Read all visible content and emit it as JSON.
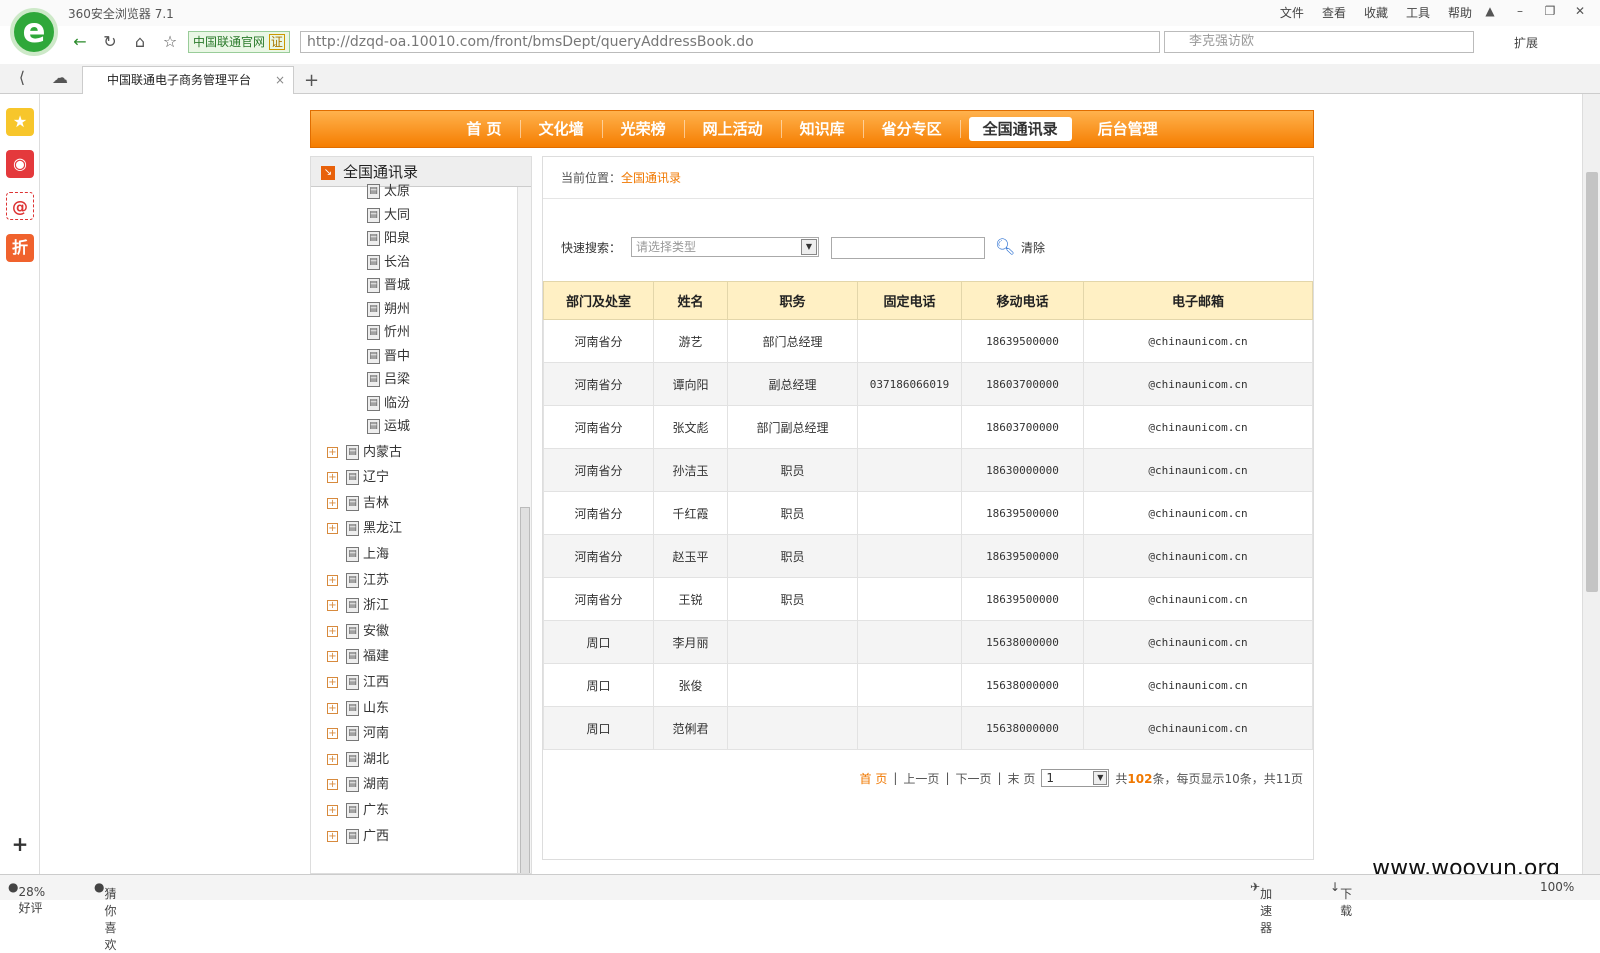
{
  "browser": {
    "app_title": "360安全浏览器 7.1",
    "menu": [
      "文件",
      "查看",
      "收藏",
      "工具",
      "帮助"
    ],
    "cert_label": "中国联通官网",
    "cert_badge": "证",
    "url": "http://dzqd-oa.10010.com/front/bmsDept/queryAddressBook.do",
    "search_placeholder": "李克强访欧",
    "extension_label": "扩展",
    "tab_title": "中国联通电子商务管理平台"
  },
  "nav": {
    "items": [
      {
        "label": "首 页"
      },
      {
        "label": "文化墙"
      },
      {
        "label": "光荣榜"
      },
      {
        "label": "网上活动"
      },
      {
        "label": "知识库"
      },
      {
        "label": "省分专区"
      },
      {
        "label": "全国通讯录",
        "active": true
      },
      {
        "label": "后台管理"
      }
    ]
  },
  "sidebar": {
    "title": "全国通讯录",
    "sub_nodes": [
      "太原",
      "大同",
      "阳泉",
      "长治",
      "晋城",
      "朔州",
      "忻州",
      "晋中",
      "吕梁",
      "临汾",
      "运城"
    ],
    "provinces": [
      {
        "name": "内蒙古",
        "expandable": true
      },
      {
        "name": "辽宁",
        "expandable": true
      },
      {
        "name": "吉林",
        "expandable": true
      },
      {
        "name": "黑龙江",
        "expandable": true
      },
      {
        "name": "上海",
        "expandable": false
      },
      {
        "name": "江苏",
        "expandable": true
      },
      {
        "name": "浙江",
        "expandable": true
      },
      {
        "name": "安徽",
        "expandable": true
      },
      {
        "name": "福建",
        "expandable": true
      },
      {
        "name": "江西",
        "expandable": true
      },
      {
        "name": "山东",
        "expandable": true
      },
      {
        "name": "河南",
        "expandable": true
      },
      {
        "name": "湖北",
        "expandable": true
      },
      {
        "name": "湖南",
        "expandable": true
      },
      {
        "name": "广东",
        "expandable": true
      },
      {
        "name": "广西",
        "expandable": true
      }
    ]
  },
  "breadcrumb": {
    "label": "当前位置：",
    "current": "全国通讯录"
  },
  "search": {
    "label": "快速搜索：",
    "type_placeholder": "请选择类型",
    "clear_label": "清除"
  },
  "table": {
    "headers": [
      "部门及处室",
      "姓名",
      "职务",
      "固定电话",
      "移动电话",
      "电子邮箱"
    ],
    "rows": [
      [
        "河南省分",
        "游艺",
        "部门总经理",
        "",
        "18639500000",
        "@chinaunicom.cn"
      ],
      [
        "河南省分",
        "谭向阳",
        "副总经理",
        "037186066019",
        "18603700000",
        "@chinaunicom.cn"
      ],
      [
        "河南省分",
        "张文彪",
        "部门副总经理",
        "",
        "18603700000",
        "@chinaunicom.cn"
      ],
      [
        "河南省分",
        "孙洁玉",
        "职员",
        "",
        "18630000000",
        "@chinaunicom.cn"
      ],
      [
        "河南省分",
        "千红霞",
        "职员",
        "",
        "18639500000",
        "@chinaunicom.cn"
      ],
      [
        "河南省分",
        "赵玉平",
        "职员",
        "",
        "18639500000",
        "@chinaunicom.cn"
      ],
      [
        "河南省分",
        "王锐",
        "职员",
        "",
        "18639500000",
        "@chinaunicom.cn"
      ],
      [
        "周口",
        "李月丽",
        "",
        "",
        "15638000000",
        "@chinaunicom.cn"
      ],
      [
        "周口",
        "张俊",
        "",
        "",
        "15638000000",
        "@chinaunicom.cn"
      ],
      [
        "周口",
        "范俐君",
        "",
        "",
        "15638000000",
        "@chinaunicom.cn"
      ]
    ]
  },
  "pager": {
    "first": "首 页",
    "prev": "上一页",
    "next": "下一页",
    "last": "末 页",
    "current_page": "1",
    "summary_prefix": "共",
    "total": "102",
    "summary_suffix": "条，每页显示10条，共11页"
  },
  "status": {
    "rating": "28%好评",
    "guess": "猜你喜欢",
    "accelerator": "加速器",
    "download": "下载",
    "zoom": "100%"
  },
  "watermark": "www.wooyun.org",
  "colors": {
    "accent": "#f57d00",
    "header_bg": "#fff0c4",
    "link_active": "#f07800"
  }
}
